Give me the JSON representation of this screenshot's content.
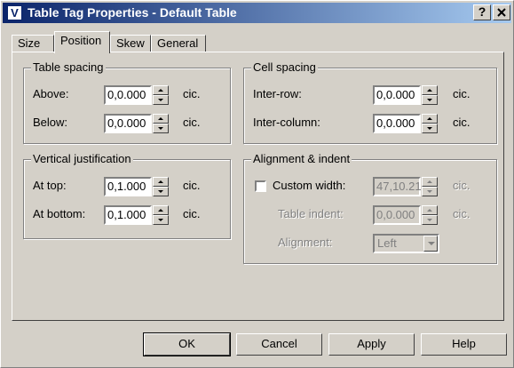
{
  "window": {
    "title": "Table Tag Properties - Default Table",
    "app_icon_letter": "V",
    "help_glyph": "?",
    "close_glyph": "X"
  },
  "tabs": [
    {
      "label": "Size",
      "active": false
    },
    {
      "label": "Position",
      "active": true
    },
    {
      "label": "Skew",
      "active": false
    },
    {
      "label": "General",
      "active": false
    }
  ],
  "table_spacing": {
    "title": "Table spacing",
    "above": {
      "label": "Above:",
      "value": "0,0.000",
      "unit": "cic."
    },
    "below": {
      "label": "Below:",
      "value": "0,0.000",
      "unit": "cic."
    }
  },
  "cell_spacing": {
    "title": "Cell spacing",
    "inter_row": {
      "label": "Inter-row:",
      "value": "0,0.000",
      "unit": "cic."
    },
    "inter_column": {
      "label": "Inter-column:",
      "value": "0,0.000",
      "unit": "cic."
    }
  },
  "vertical_justification": {
    "title": "Vertical justification",
    "at_top": {
      "label": "At top:",
      "value": "0,1.000",
      "unit": "cic."
    },
    "at_bottom": {
      "label": "At bottom:",
      "value": "0,1.000",
      "unit": "cic."
    }
  },
  "alignment_indent": {
    "title": "Alignment & indent",
    "custom_width": {
      "label": "Custom width:",
      "checked": false,
      "value": "47,10.21",
      "unit": "cic."
    },
    "table_indent": {
      "label": "Table indent:",
      "value": "0,0.000",
      "unit": "cic."
    },
    "alignment": {
      "label": "Alignment:",
      "value": "Left"
    }
  },
  "buttons": {
    "ok": "OK",
    "cancel": "Cancel",
    "apply": "Apply",
    "help": "Help"
  }
}
